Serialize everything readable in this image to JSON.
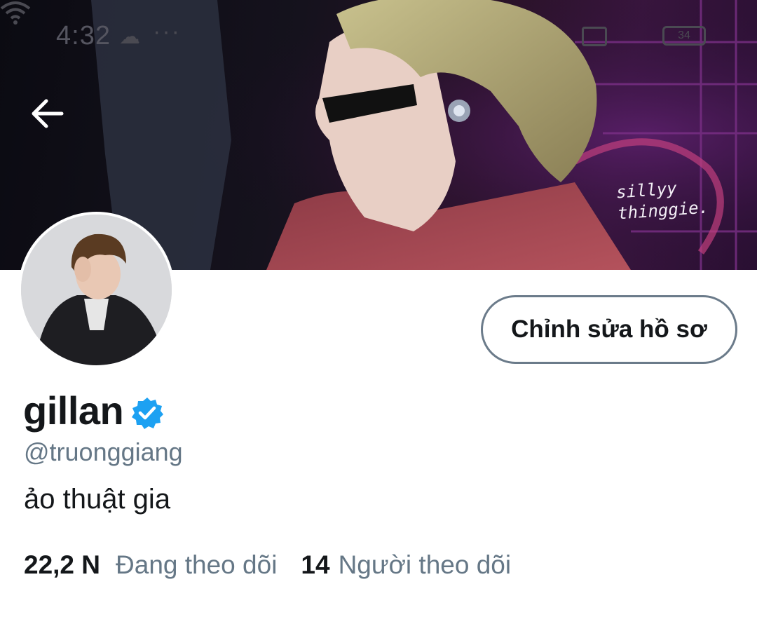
{
  "status_bar": {
    "time": "4:32",
    "cloud_icon": "cloud-icon",
    "more_icon": "more-dots",
    "battery": "34"
  },
  "header": {
    "back_icon": "arrow-left-icon",
    "watermark_line1": "sillyy",
    "watermark_line2": "thinggie."
  },
  "profile": {
    "display_name": "gillan",
    "verified_icon": "verified-badge-icon",
    "handle": "@truonggiang",
    "bio": "ảo thuật gia",
    "edit_button_label": "Chỉnh sửa hồ sơ"
  },
  "stats": {
    "following_count": "22,2 N",
    "following_label": "Đang theo dõi",
    "followers_count": "14",
    "followers_label": "Người theo dõi"
  },
  "colors": {
    "primary_text": "#14171a",
    "secondary_text": "#657786",
    "verified_blue": "#1da1f2",
    "button_border": "#6b7b8a"
  }
}
